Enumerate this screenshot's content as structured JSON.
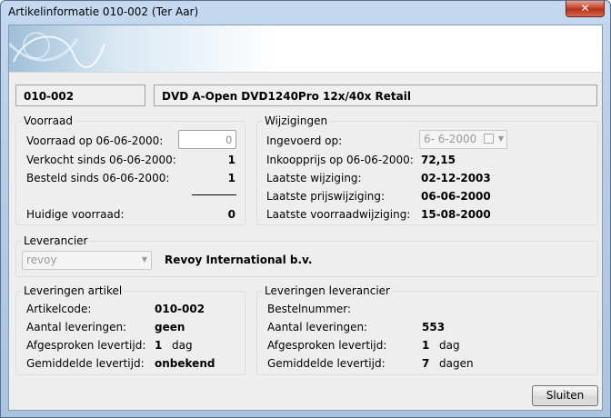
{
  "window": {
    "title": "Artikelinformatie 010-002 (Ter Aar)",
    "close_glyph": "✕"
  },
  "header": {
    "article_code": "010-002",
    "article_name": "DVD A-Open DVD1240Pro 12x/40x Retail"
  },
  "voorraad": {
    "title": "Voorraad",
    "rows": [
      {
        "label": "Voorraad op 06-06-2000:",
        "value": "0"
      },
      {
        "label": "Verkocht sinds 06-06-2000:",
        "value": "1"
      },
      {
        "label": "Besteld sinds 06-06-2000:",
        "value": "1"
      }
    ],
    "huidige_label": "Huidige voorraad:",
    "huidige_value": "0"
  },
  "wijzigingen": {
    "title": "Wijzigingen",
    "ingevoerd_label": "Ingevoerd op:",
    "ingevoerd_value": "6- 6-2000",
    "inkoopprijs_label": "Inkoopprijs op 06-06-2000:",
    "inkoopprijs_value": "72,15",
    "laatste_wijziging_label": "Laatste wijziging:",
    "laatste_wijziging_value": "02-12-2003",
    "laatste_prijs_label": "Laatste prijswijziging:",
    "laatste_prijs_value": "06-06-2000",
    "laatste_voorraad_label": "Laatste voorraadwijziging:",
    "laatste_voorraad_value": "15-08-2000"
  },
  "leverancier": {
    "title": "Leverancier",
    "combo_value": "revoy",
    "name": "Revoy International b.v."
  },
  "leveringen_artikel": {
    "title": "Leveringen artikel",
    "artikelcode_label": "Artikelcode:",
    "artikelcode_value": "010-002",
    "aantal_label": "Aantal leveringen:",
    "aantal_value": "geen",
    "afgesproken_label": "Afgesproken levertijd:",
    "afgesproken_value": "1",
    "afgesproken_unit": "dag",
    "gemiddelde_label": "Gemiddelde levertijd:",
    "gemiddelde_value": "onbekend"
  },
  "leveringen_leverancier": {
    "title": "Leveringen leverancier",
    "bestelnummer_label": "Bestelnummer:",
    "aantal_label": "Aantal leveringen:",
    "aantal_value": "553",
    "afgesproken_label": "Afgesproken levertijd:",
    "afgesproken_value": "1",
    "afgesproken_unit": "dag",
    "gemiddelde_label": "Gemiddelde levertijd:",
    "gemiddelde_value": "7",
    "gemiddelde_unit": "dagen"
  },
  "buttons": {
    "close_label": "Sluiten"
  },
  "icons": {
    "close": "close-icon",
    "calendar": "calendar-icon",
    "dropdown": "chevron-down-icon"
  }
}
